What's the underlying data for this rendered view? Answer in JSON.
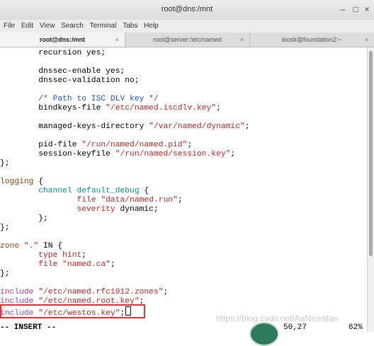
{
  "window": {
    "title": "root@dns:/mnt"
  },
  "menu": [
    "File",
    "Edit",
    "View",
    "Search",
    "Terminal",
    "Tabs",
    "Help"
  ],
  "tabs": [
    {
      "label": "root@dns:/mnt",
      "active": true
    },
    {
      "label": "root@server:/etc/named",
      "active": false
    },
    {
      "label": "kiosk@foundation2:~",
      "active": false
    }
  ],
  "editor": {
    "lines": [
      "        recursion yes;",
      "",
      "        dnssec-enable yes;",
      "        dnssec-validation no;",
      "",
      "        /* Path to ISC DLV key */",
      "        bindkeys-file \"/etc/named.iscdlv.key\";",
      "",
      "        managed-keys-directory \"/var/named/dynamic\";",
      "",
      "        pid-file \"/run/named/named.pid\";",
      "        session-keyfile \"/run/named/session.key\";",
      "};",
      "",
      "logging {",
      "        channel default_debug {",
      "                file \"data/named.run\";",
      "                severity dynamic;",
      "        };",
      "};",
      "",
      "zone \".\" IN {",
      "        type hint;",
      "        file \"named.ca\";",
      "};",
      "",
      "include \"/etc/named.rfc1912.zones\";",
      "include \"/etc/named.root.key\";",
      "include \"/etc/westos.key\";"
    ],
    "mode": "-- INSERT --",
    "position": "50,27",
    "percent": "62%"
  },
  "watermark": "https://blog.csdn.net/AaNiceMan"
}
